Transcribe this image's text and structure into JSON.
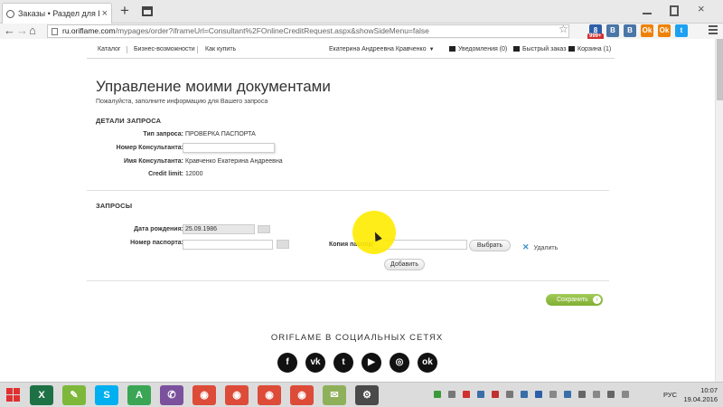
{
  "browser": {
    "tab_title": "Заказы • Раздел для Консульта",
    "tab_close": "×",
    "new_tab": "+",
    "url_host": "ru.oriflame.com",
    "url_path": "/mypages/order?iframeUrl=Consultant%2FOnlineCreditRequest.aspx&showSideMenu=false",
    "back_glyph": "←",
    "forward_glyph": "→",
    "reload_glyph": "↻",
    "home_glyph": "⌂",
    "star_glyph": "☆",
    "ext_badge": "999+",
    "window_close": "×",
    "extensions": [
      {
        "label": "8",
        "color": "#2d5ea8"
      },
      {
        "label": "В",
        "color": "#4a76a8"
      },
      {
        "label": "В",
        "color": "#4a76a8"
      },
      {
        "label": "Ok",
        "color": "#ee8208"
      },
      {
        "label": "Ok",
        "color": "#ee8208"
      },
      {
        "label": "t",
        "color": "#1da1f2"
      }
    ]
  },
  "site_nav": {
    "links": [
      "Каталог",
      "Бизнес-возможности",
      "Как купить"
    ],
    "user": "Екатерина Андреевна Кравченко",
    "user_caret": "▼",
    "notifications": "Уведомления (0)",
    "quick_order": "Быстрый заказ",
    "cart": "Корзина (1)"
  },
  "page": {
    "title": "Управление моими документами",
    "subtitle": "Пожалуйста, заполните информацию для Вашего запроса"
  },
  "details": {
    "heading": "ДЕТАЛИ ЗАПРОСА",
    "request_type_label": "Тип запроса:",
    "request_type_value": "ПРОВЕРКА ПАСПОРТА",
    "consultant_number_label": "Номер Консультанта:",
    "consultant_number_value": "",
    "consultant_name_label": "Имя Консультанта:",
    "consultant_name_value": "Кравченко Екатерина Андреевна",
    "credit_limit_label": "Credit limit:",
    "credit_limit_value": "12000"
  },
  "requests": {
    "heading": "ЗАПРОСЫ",
    "birth_date_label": "Дата рождения:",
    "birth_date_value": "25.09.1986",
    "passport_number_label": "Номер паспорта:",
    "passport_number_value": "",
    "passport_copy_label": "Копия паспорта:",
    "passport_copy_value": "",
    "browse_button": "Выбрать",
    "delete_icon": "✕",
    "delete_label": "Удалить",
    "add_button": "Добавить",
    "save_button": "Сохранить",
    "save_arrow": "›"
  },
  "social": {
    "title": "ORIFLAME В СОЦИАЛЬНЫХ СЕТЯХ",
    "icons": [
      {
        "name": "facebook-icon",
        "glyph": "f"
      },
      {
        "name": "vk-icon",
        "glyph": "vk"
      },
      {
        "name": "twitter-icon",
        "glyph": "t"
      },
      {
        "name": "youtube-icon",
        "glyph": "▶"
      },
      {
        "name": "instagram-icon",
        "glyph": "◎"
      },
      {
        "name": "odnoklassniki-icon",
        "glyph": "ok"
      }
    ]
  },
  "taskbar": {
    "apps": [
      {
        "name": "excel-app",
        "glyph": "X",
        "color": "#1e7145"
      },
      {
        "name": "notes-app",
        "glyph": "✎",
        "color": "#7db83a"
      },
      {
        "name": "skype-app",
        "glyph": "S",
        "color": "#00aff0"
      },
      {
        "name": "autocad-app",
        "glyph": "A",
        "color": "#3aa655"
      },
      {
        "name": "viber-app",
        "glyph": "✆",
        "color": "#7b519d"
      },
      {
        "name": "chrome-app-1",
        "glyph": "◉",
        "color": "#dd4b39"
      },
      {
        "name": "chrome-app-2",
        "glyph": "◉",
        "color": "#dd4b39"
      },
      {
        "name": "chrome-app-3",
        "glyph": "◉",
        "color": "#dd4b39"
      },
      {
        "name": "chrome-app-4",
        "glyph": "◉",
        "color": "#dd4b39"
      },
      {
        "name": "mail-app",
        "glyph": "✉",
        "color": "#8fb05a"
      },
      {
        "name": "tool-app",
        "glyph": "⚙",
        "color": "#4a4a4a"
      }
    ],
    "language": "РУС",
    "time": "10:07",
    "date": "19.04.2016"
  }
}
